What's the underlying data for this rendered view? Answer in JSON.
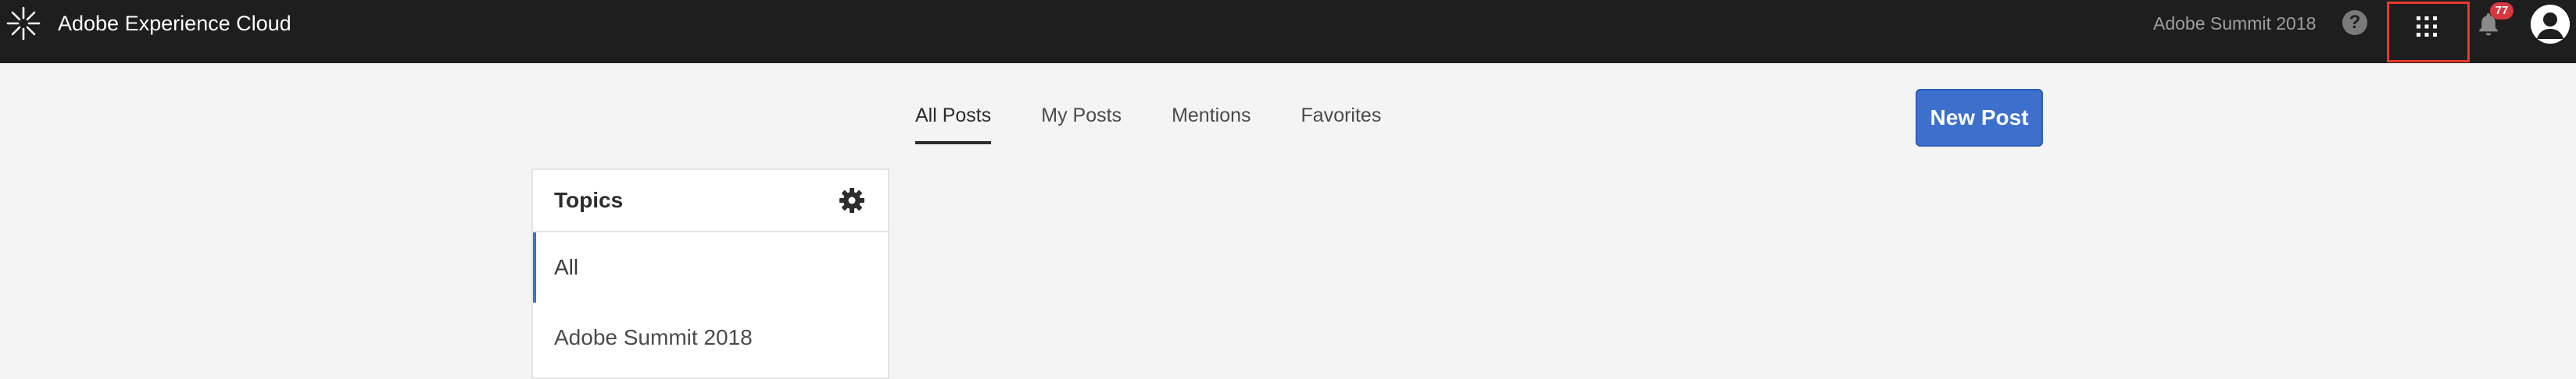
{
  "shell": {
    "brand_text": "Adobe Experience Cloud",
    "org_name": "Adobe Summit 2018",
    "help_icon": "help-icon",
    "apps_icon": "app-grid-icon",
    "notifications_icon": "bell-icon",
    "notification_count": "77",
    "avatar_icon": "user-avatar-icon",
    "highlight_color": "#e8382c"
  },
  "tabs": [
    {
      "label": "All Posts",
      "active": true
    },
    {
      "label": "My Posts",
      "active": false
    },
    {
      "label": "Mentions",
      "active": false
    },
    {
      "label": "Favorites",
      "active": false
    }
  ],
  "actions": {
    "new_post_label": "New Post",
    "accent_color": "#3d6fcc"
  },
  "topics": {
    "title": "Topics",
    "settings_icon": "gear-icon",
    "items": [
      {
        "label": "All",
        "selected": true
      },
      {
        "label": "Adobe Summit 2018",
        "selected": false
      }
    ]
  }
}
